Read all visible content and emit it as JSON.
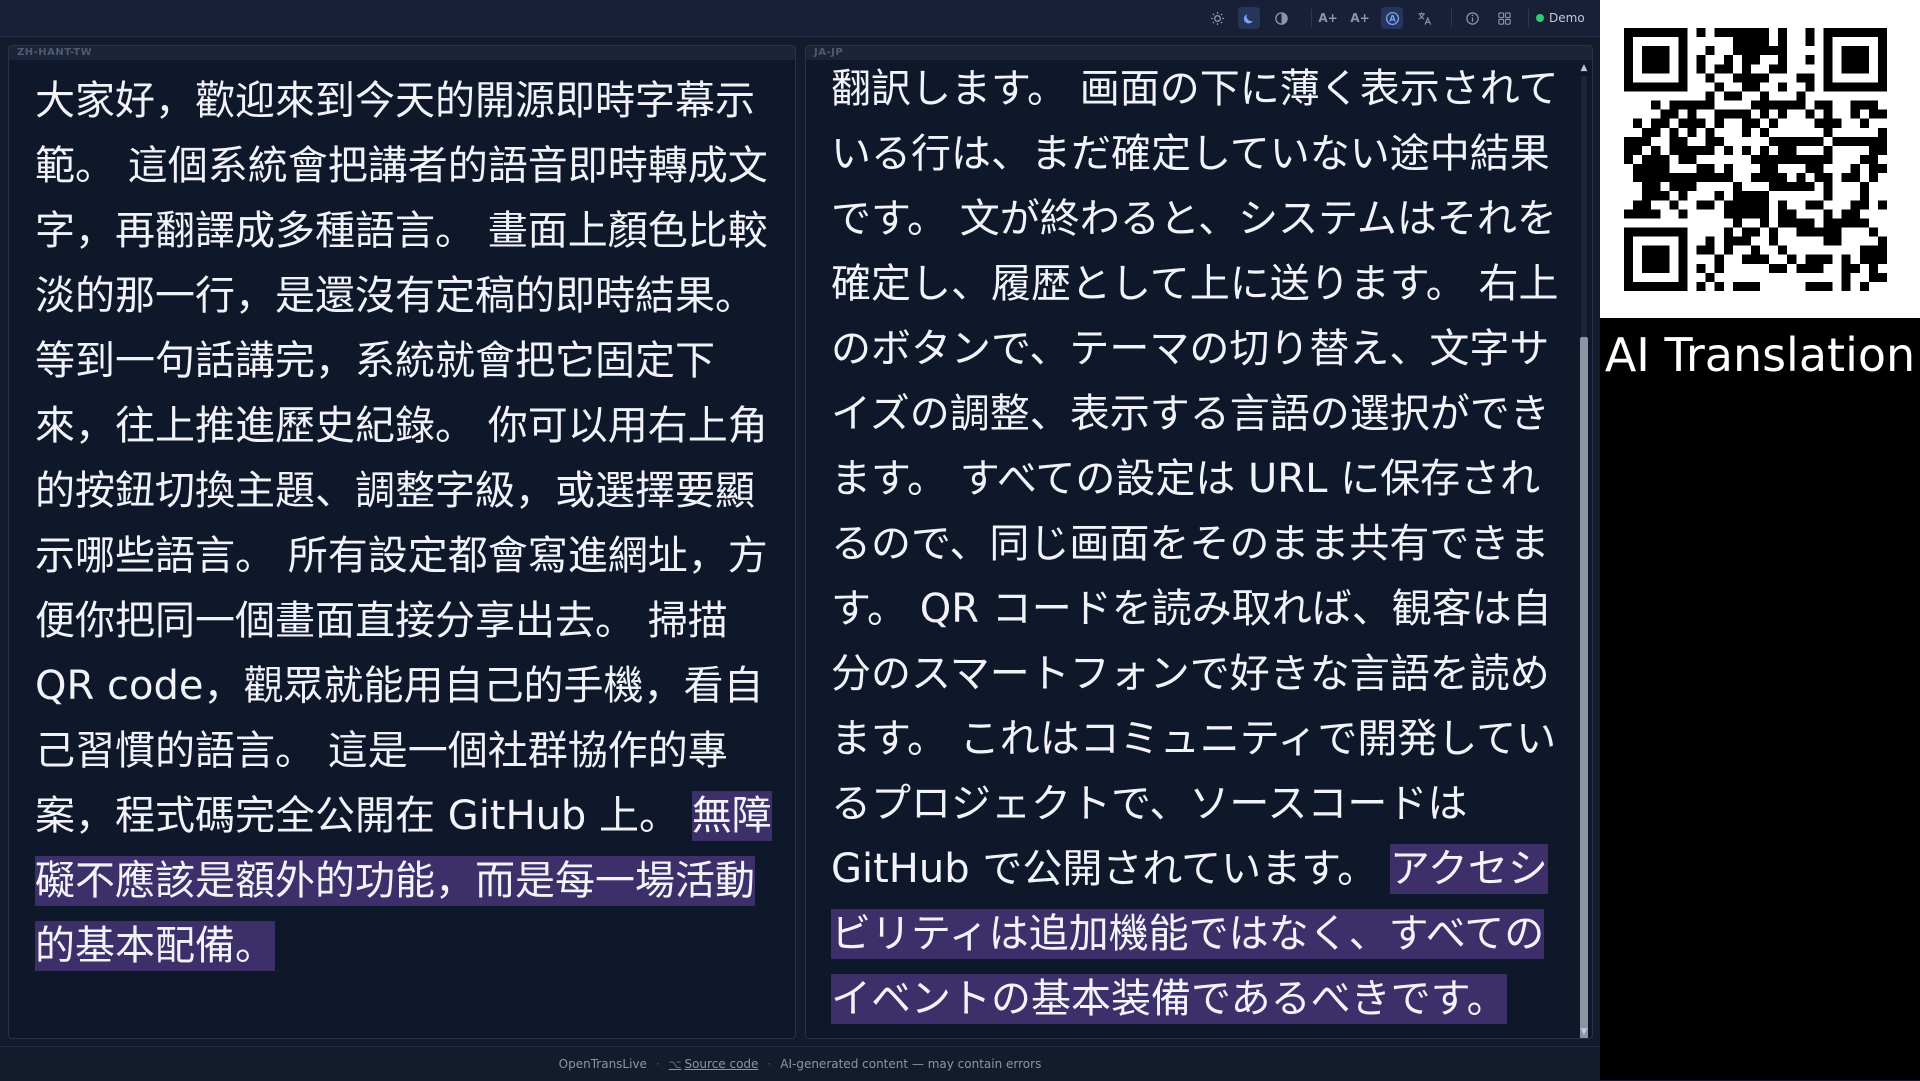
{
  "topbar": {
    "icons": [
      "sun-icon",
      "moon-icon",
      "contrast-icon",
      "font-increase-icon",
      "font-decrease-icon",
      "auto-icon",
      "translate-icon",
      "info-icon",
      "grid-icon"
    ],
    "font_increase_label": "A+",
    "font_decrease_label": "A+",
    "status_label": "Demo",
    "status_color": "#2ecc71",
    "active_theme": "dark"
  },
  "panels": {
    "zh": {
      "lang_code": "ZH-HANT-TW",
      "final_text": "大家好，歡迎來到今天的開源即時字幕示範。 這個系統會把講者的語音即時轉成文字，再翻譯成多種語言。 畫面上顏色比較淡的那一行，是還沒有定稿的即時結果。 等到一句話講完，系統就會把它固定下來，往上推進歷史紀錄。 你可以用右上角的按鈕切換主題、調整字級，或選擇要顯示哪些語言。 所有設定都會寫進網址，方便你把同一個畫面直接分享出去。 掃描 QR code，觀眾就能用自己的手機，看自己習慣的語言。 這是一個社群協作的專案，程式碼完全公開在 GitHub 上。 ",
      "highlight_text": "無障礙不應該是額外的功能，而是每一場活動的基本配備。"
    },
    "ja": {
      "lang_code": "JA-JP",
      "final_text": "翻訳します。 画面の下に薄く表示されている行は、まだ確定していない途中結果です。 文が終わると、システムはそれを確定し、履歴として上に送ります。 右上のボタンで、テーマの切り替え、文字サイズの調整、表示する言語の選択ができます。 すべての設定は URL に保存されるので、同じ画面をそのまま共有できます。 QR コードを読み取れば、観客は自分のスマートフォンで好きな言語を読めます。 これはコミュニティで開発しているプロジェクトで、ソースコードは GitHub で公開されています。 ",
      "highlight_text": "アクセシビリティは追加機能ではなく、すべてのイベントの基本装備であるべきです。"
    }
  },
  "footer": {
    "app_name": "OpenTransLive",
    "source_label": "Source code",
    "disclaimer": "AI-generated content — may contain errors"
  },
  "sidebar": {
    "qr_label": "AI Translation"
  },
  "colors": {
    "highlight": "#3d2f6a",
    "text": "#f1f3f8",
    "panel_bg": "#0f172a",
    "accent": "#7aa2f7"
  }
}
